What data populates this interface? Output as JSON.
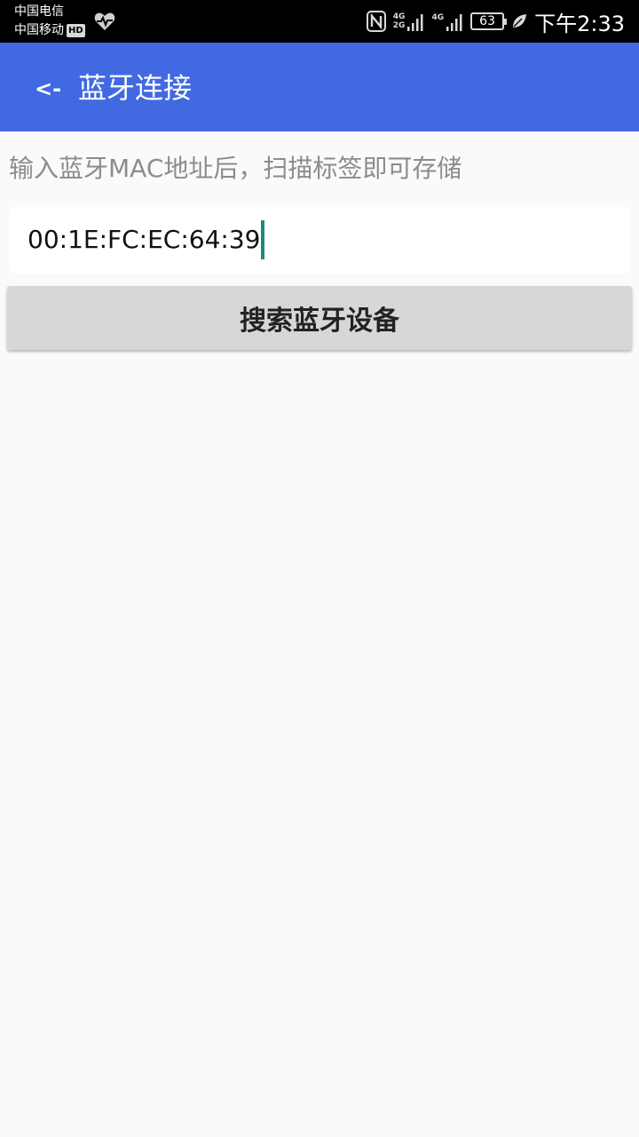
{
  "status_bar": {
    "carrier_1": "中国电信",
    "carrier_2": "中国移动",
    "hd_label": "HD",
    "net_top": "4G",
    "net_bottom": "2G",
    "net_second": "4G",
    "battery_level": "63",
    "time": "下午2:33",
    "icons": [
      "heart-rate-icon",
      "nfc-icon",
      "signal-icon",
      "battery-icon",
      "leaf-icon"
    ]
  },
  "app_bar": {
    "back_label": "<-",
    "title": "蓝牙连接",
    "color": "#4169e1"
  },
  "main": {
    "hint": "输入蓝牙MAC地址后，扫描标签即可存储",
    "mac_input": {
      "value": "00:1E:FC:EC:64:39"
    },
    "search_button_label": "搜索蓝牙设备"
  }
}
